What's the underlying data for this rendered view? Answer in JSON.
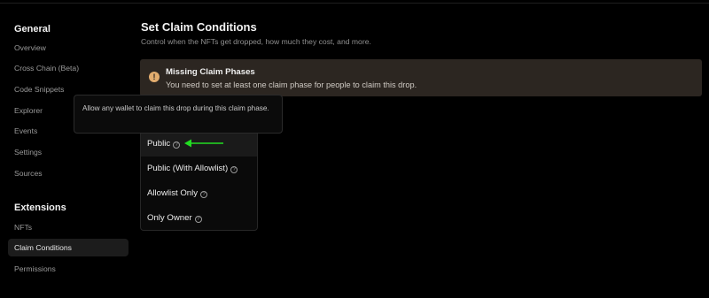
{
  "sidebar": {
    "sections": [
      {
        "heading": "General",
        "items": [
          {
            "label": "Overview"
          },
          {
            "label": "Cross Chain (Beta)"
          },
          {
            "label": "Code Snippets"
          },
          {
            "label": "Explorer"
          },
          {
            "label": "Events"
          },
          {
            "label": "Settings"
          },
          {
            "label": "Sources"
          }
        ]
      },
      {
        "heading": "Extensions",
        "items": [
          {
            "label": "NFTs"
          },
          {
            "label": "Claim Conditions",
            "active": true
          },
          {
            "label": "Permissions"
          }
        ]
      }
    ]
  },
  "main": {
    "title": "Set Claim Conditions",
    "subtitle": "Control when the NFTs get dropped, how much they cost, and more.",
    "alert": {
      "icon": "exclamation-icon",
      "title": "Missing Claim Phases",
      "description": "You need to set at least one claim phase for people to claim this drop."
    },
    "tooltip": {
      "text": "Allow any wallet to claim this drop during this claim phase."
    },
    "menu": {
      "items": [
        {
          "label": "Public",
          "icon": "help-circle-icon",
          "highlighted": true
        },
        {
          "label": "Public (With Allowlist)",
          "icon": "help-circle-icon"
        },
        {
          "label": "Allowlist Only",
          "icon": "help-circle-icon"
        },
        {
          "label": "Only Owner",
          "icon": "help-circle-icon"
        }
      ]
    },
    "annotation": {
      "arrow_color": "#22dd22"
    }
  },
  "colors": {
    "background": "#000000",
    "alert_background": "#2c2621",
    "alert_icon": "#e2ac6e",
    "active_item": "#1c1c1c"
  }
}
